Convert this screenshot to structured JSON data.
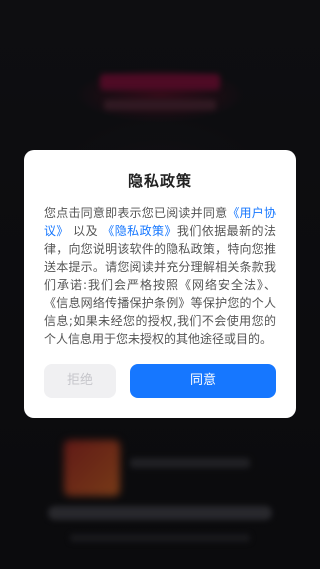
{
  "dialog": {
    "title": "隐私政策",
    "body_intro": "您点击同意即表示您已阅读并同意",
    "user_agreement_link": "《用户协议》",
    "and_text": "以及",
    "privacy_policy_link": "《隐私政策》",
    "body_main": "我们依据最新的法律，向您说明该软件的隐私政策，特向您推送本提示。请您阅读并充分理解相关条款我们承诺:我们会严格按照《网络安全法》、《信息网络传播保护条例》等保护您的个人信息;如果未经您的授权,我们不会使用您的个人信息用于您未授权的其他途径或目的。",
    "reject_label": "拒绝",
    "agree_label": "同意"
  },
  "colors": {
    "accent": "#1677ff",
    "reject_bg": "#f0f0f2",
    "reject_text": "#c6c6cb"
  }
}
